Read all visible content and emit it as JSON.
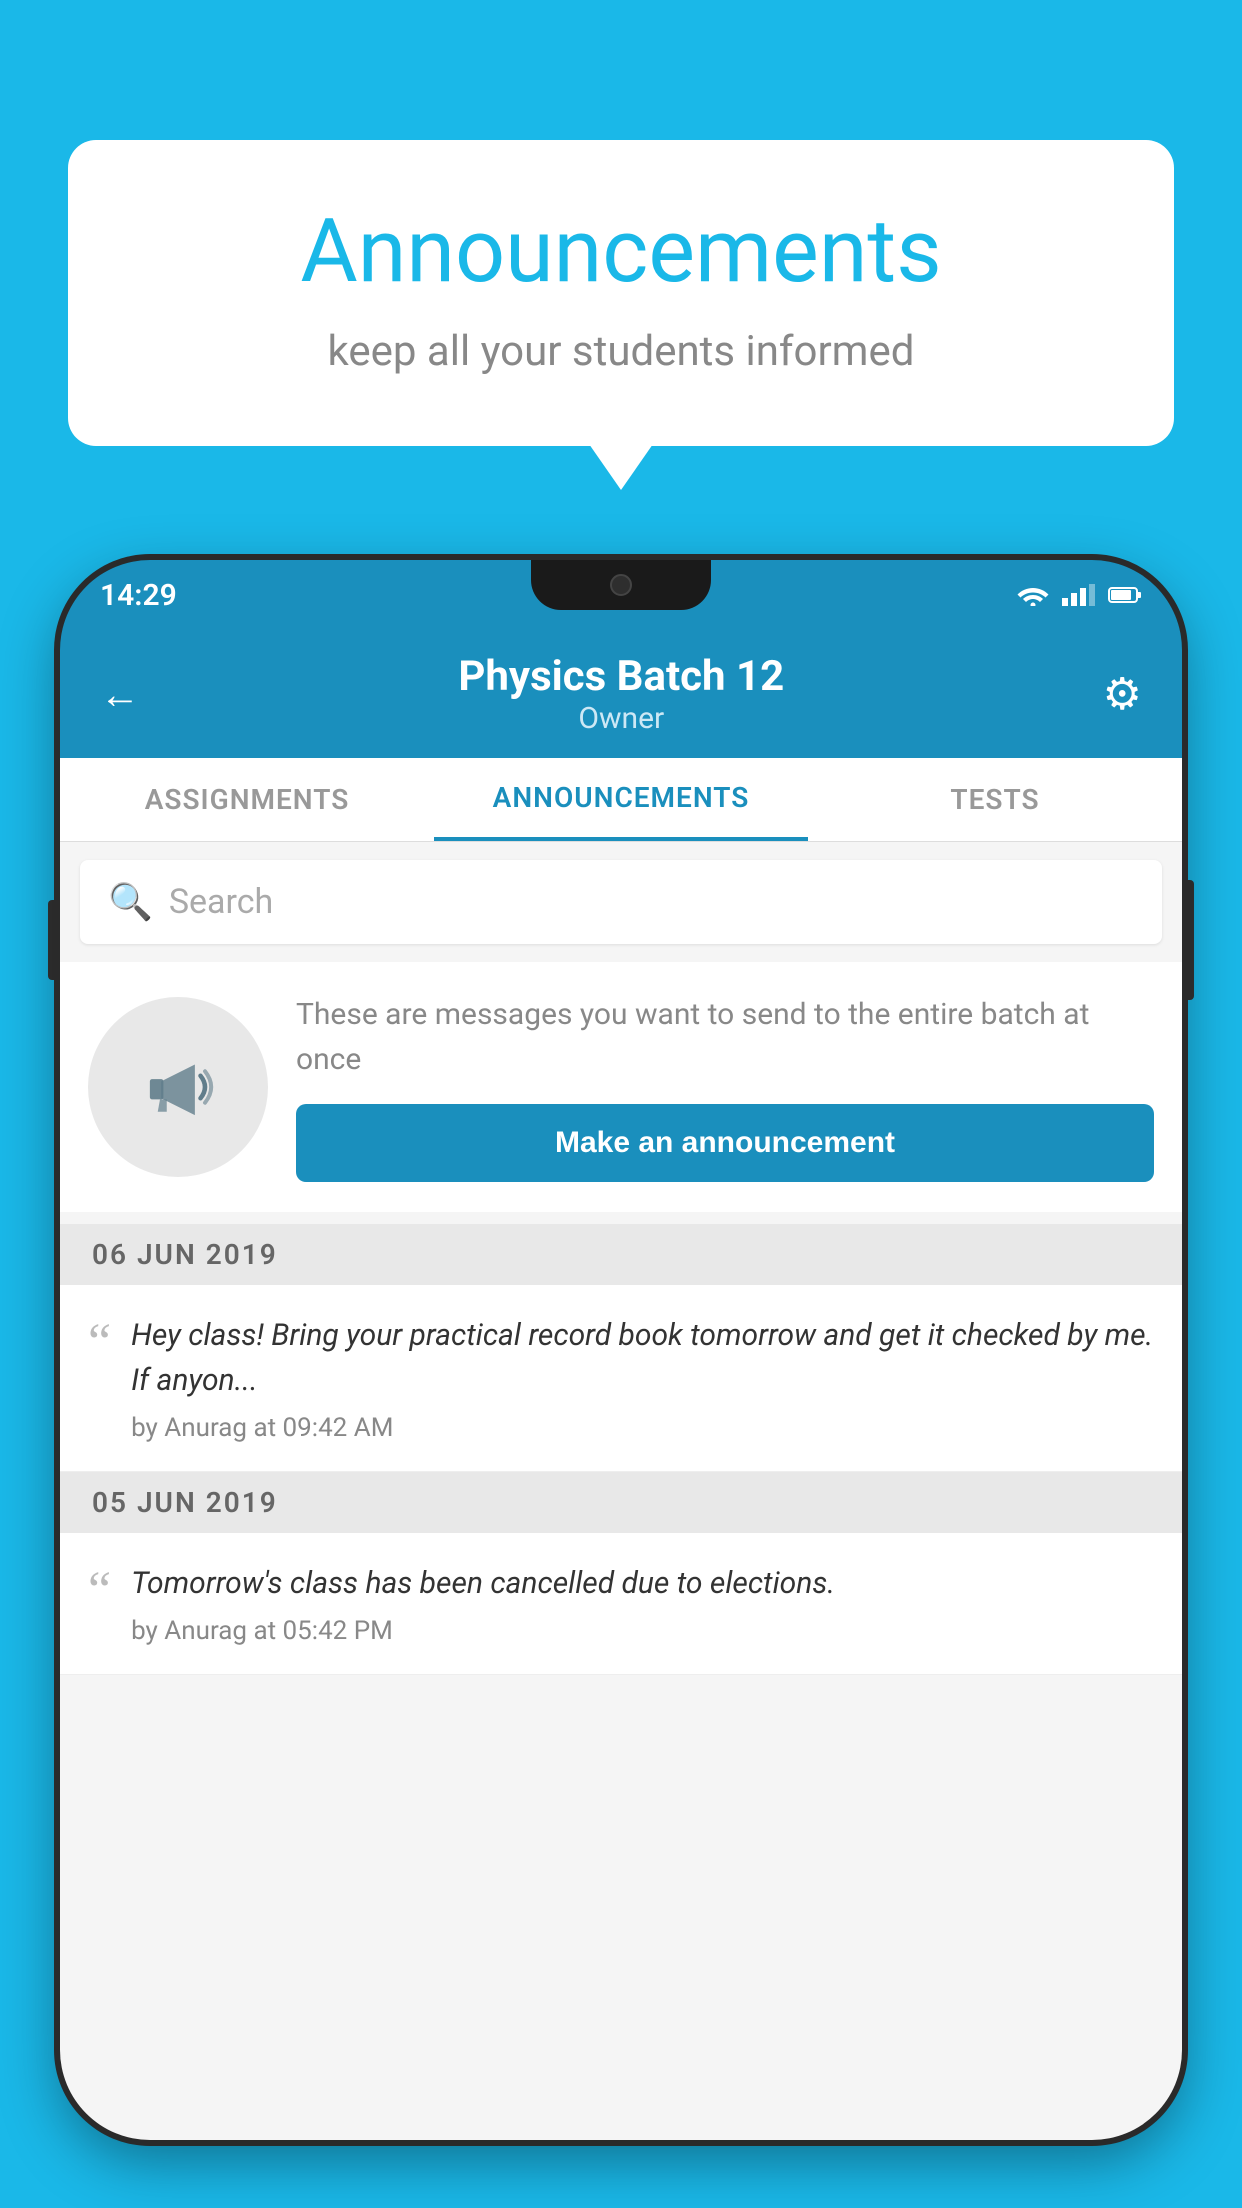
{
  "background_color": "#1ab8e8",
  "speech_bubble": {
    "title": "Announcements",
    "subtitle": "keep all your students informed"
  },
  "phone": {
    "status_bar": {
      "time": "14:29"
    },
    "header": {
      "batch_name": "Physics Batch 12",
      "role": "Owner",
      "back_label": "←",
      "settings_label": "⚙"
    },
    "tabs": [
      {
        "label": "ASSIGNMENTS",
        "active": false
      },
      {
        "label": "ANNOUNCEMENTS",
        "active": true
      },
      {
        "label": "TESTS",
        "active": false
      }
    ],
    "search": {
      "placeholder": "Search"
    },
    "promo": {
      "description": "These are messages you want to send to the entire batch at once",
      "button_label": "Make an announcement"
    },
    "announcements": [
      {
        "date": "06  JUN  2019",
        "text": "Hey class! Bring your practical record book tomorrow and get it checked by me. If anyon...",
        "meta": "by Anurag at 09:42 AM"
      },
      {
        "date": "05  JUN  2019",
        "text": "Tomorrow's class has been cancelled due to elections.",
        "meta": "by Anurag at 05:42 PM"
      }
    ]
  }
}
